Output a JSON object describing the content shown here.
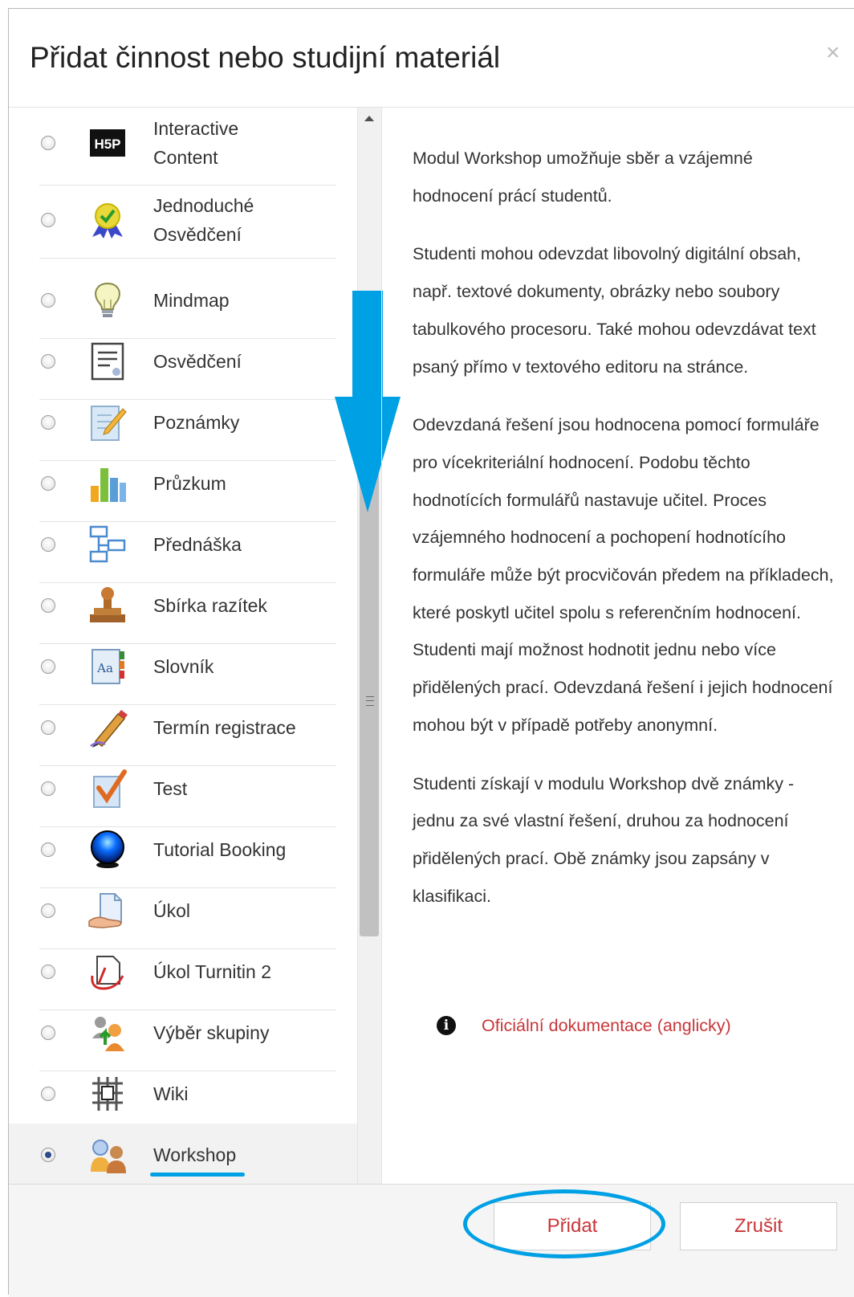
{
  "dialog": {
    "title": "Přidat činnost nebo studijní materiál",
    "close_glyph": "×"
  },
  "options": [
    {
      "label": "Interactive Content",
      "icon": "h5p-icon",
      "selected": false
    },
    {
      "label": "Jednoduché Osvědčení",
      "icon": "certificate-ribbon-icon",
      "selected": false
    },
    {
      "label": "Mindmap",
      "icon": "lightbulb-icon",
      "selected": false
    },
    {
      "label": "Osvědčení",
      "icon": "certificate-document-icon",
      "selected": false
    },
    {
      "label": "Poznámky",
      "icon": "notes-pencil-icon",
      "selected": false
    },
    {
      "label": "Průzkum",
      "icon": "bar-chart-icon",
      "selected": false
    },
    {
      "label": "Přednáška",
      "icon": "lesson-flowchart-icon",
      "selected": false
    },
    {
      "label": "Sbírka razítek",
      "icon": "stamp-icon",
      "selected": false
    },
    {
      "label": "Slovník",
      "icon": "glossary-icon",
      "selected": false
    },
    {
      "label": "Termín registrace",
      "icon": "pen-icon",
      "selected": false
    },
    {
      "label": "Test",
      "icon": "quiz-checkmark-icon",
      "selected": false
    },
    {
      "label": "Tutorial Booking",
      "icon": "blue-sphere-icon",
      "selected": false
    },
    {
      "label": "Úkol",
      "icon": "assignment-hand-icon",
      "selected": false
    },
    {
      "label": "Úkol Turnitin 2",
      "icon": "turnitin-icon",
      "selected": false
    },
    {
      "label": "Výběr skupiny",
      "icon": "group-choice-icon",
      "selected": false
    },
    {
      "label": "Wiki",
      "icon": "wiki-icon",
      "selected": false
    },
    {
      "label": "Workshop",
      "icon": "workshop-people-icon",
      "selected": true
    }
  ],
  "description": {
    "paragraphs": [
      "Modul Workshop umožňuje sběr a vzájemné hodnocení prácí studentů.",
      "Studenti mohou odevzdat libovolný digitální obsah, např. textové dokumenty, obrázky nebo soubory tabulkového procesoru. Také mohou odevzdávat text psaný přímo v textového editoru na stránce.",
      "Odevzdaná řešení jsou hodnocena pomocí formuláře pro vícekriteriální hodnocení. Podobu těchto hodnotících formulářů nastavuje učitel. Proces vzájemného hodnocení a pochopení hodnotícího formuláře může být procvičován předem na příkladech, které poskytl učitel spolu s referenčním hodnocení. Studenti mají možnost hodnotit jednu nebo více přidělených prací. Odevzdaná řešení i jejich hodnocení mohou být v případě potřeby anonymní.",
      "Studenti získají v modulu Workshop dvě známky - jednu za své vlastní řešení, druhou za hodnocení přidělených prací. Obě známky jsou zapsány v klasifikaci."
    ],
    "doc_link": "Oficiální dokumentace (anglicky)",
    "info_glyph": "i"
  },
  "footer": {
    "add_label": "Přidat",
    "cancel_label": "Zrušit"
  },
  "colors": {
    "accent_blue": "#00a0e4",
    "link_red": "#c8363a"
  }
}
